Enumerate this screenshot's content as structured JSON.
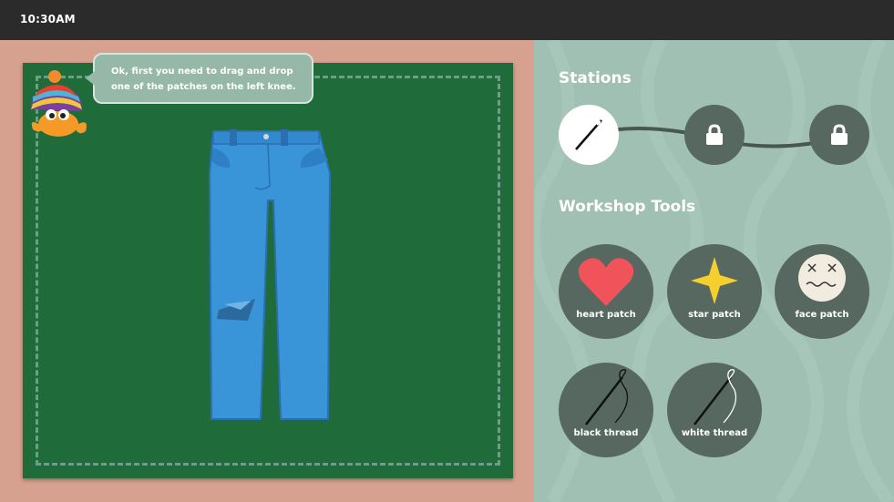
{
  "status_bar": {
    "time": "10:30AM"
  },
  "instruction": {
    "text": "Ok, first you need to drag and drop one of the patches on the left knee."
  },
  "stations": {
    "title": "Stations",
    "items": [
      {
        "icon": "needle-icon",
        "state": "active"
      },
      {
        "icon": "lock-icon",
        "state": "locked"
      },
      {
        "icon": "lock-icon",
        "state": "locked"
      }
    ]
  },
  "workshop_tools": {
    "title": "Workshop Tools",
    "items": [
      {
        "label": "heart patch",
        "icon": "heart-patch-icon"
      },
      {
        "label": "star patch",
        "icon": "star-patch-icon"
      },
      {
        "label": "face patch",
        "icon": "face-patch-icon"
      },
      {
        "label": "black thread",
        "icon": "black-thread-icon"
      },
      {
        "label": "white thread",
        "icon": "white-thread-icon"
      }
    ]
  },
  "colors": {
    "board": "#1f6b3a",
    "panel": "#9fc0b3",
    "station": "#566860",
    "jeans": "#3a94d8",
    "heart": "#f05359",
    "star": "#f4cf2e"
  }
}
